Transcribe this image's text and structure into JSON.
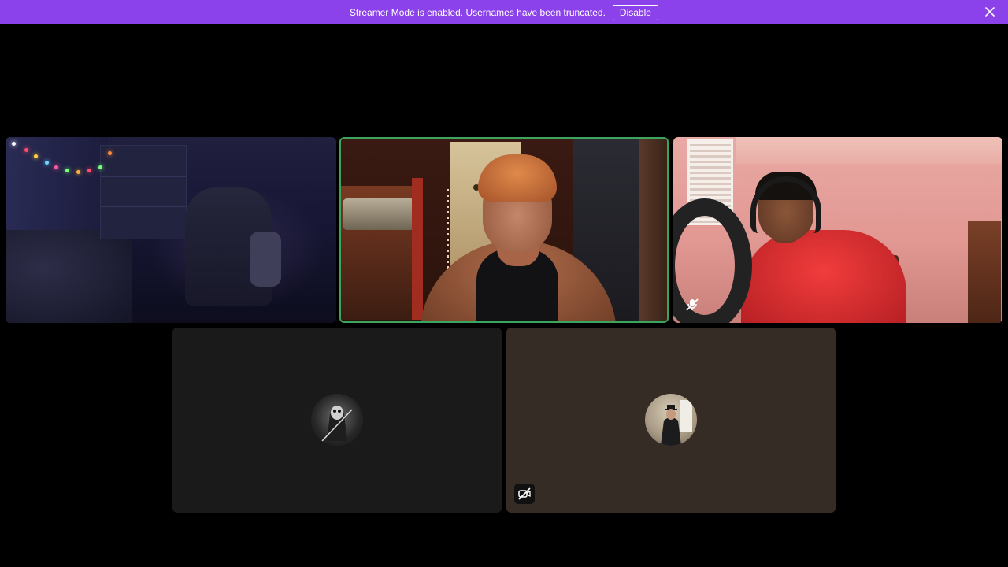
{
  "banner": {
    "message": "Streamer Mode is enabled. Usernames have been truncated.",
    "disable_label": "Disable",
    "background": "#8c42ea"
  },
  "participants": [
    {
      "id": "p1",
      "video": "on",
      "speaking": false,
      "muted": false
    },
    {
      "id": "p2",
      "video": "on",
      "speaking": true,
      "muted": false
    },
    {
      "id": "p3",
      "video": "on",
      "speaking": false,
      "muted": true
    },
    {
      "id": "p4",
      "video": "off",
      "avatar": "avatar-reaper",
      "muted": false
    },
    {
      "id": "p5",
      "video": "off",
      "avatar": "avatar-suit",
      "muted": false,
      "camera_off_icon": "video-off-icon"
    }
  ],
  "colors": {
    "speaking_border": "#3ba55d",
    "tile_dark": "#1a1a1a",
    "tile_brown": "#352c26"
  }
}
